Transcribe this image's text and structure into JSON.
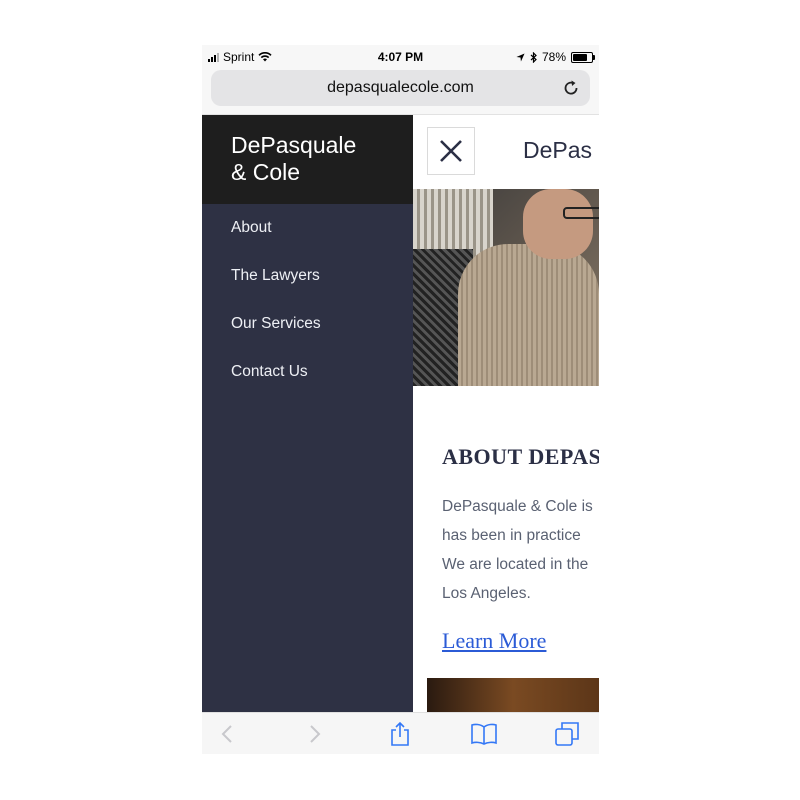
{
  "status_bar": {
    "carrier": "Sprint",
    "time": "4:07 PM",
    "battery_percent": "78%"
  },
  "browser": {
    "url": "depasqualecole.com"
  },
  "menu": {
    "brand_line1": "DePasquale",
    "brand_line2": "& Cole",
    "items": [
      {
        "label": "About"
      },
      {
        "label": "The Lawyers"
      },
      {
        "label": "Our Services"
      },
      {
        "label": "Contact Us"
      }
    ]
  },
  "page": {
    "header_brand": "DePas",
    "about_heading": "ABOUT DEPAS",
    "about_lines": [
      "DePasquale & Cole is",
      "has been in practice",
      "We are located in the",
      "Los Angeles."
    ],
    "learn_more": "Learn More"
  },
  "colors": {
    "menu_bg": "#2e3144",
    "menu_header_bg": "#1e1e1e",
    "link": "#2b5bd6",
    "ios_blue": "#3478f6"
  }
}
